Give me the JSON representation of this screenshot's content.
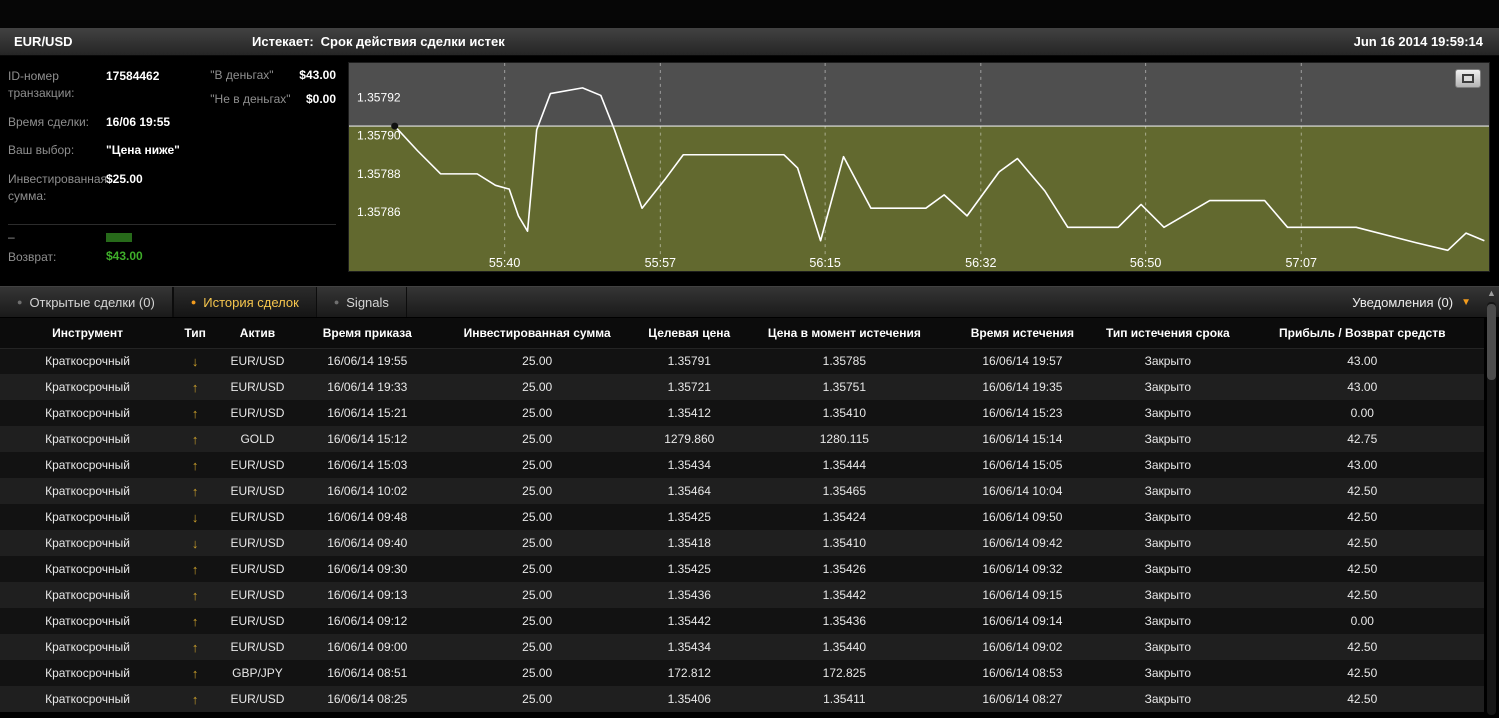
{
  "header": {
    "asset": "EUR/USD",
    "expires_label": "Истекает:",
    "expires_text": "Срок действия сделки истек",
    "datetime": "Jun 16 2014  19:59:14"
  },
  "trade_info": {
    "rows": [
      {
        "label": "ID-номер транзакции:",
        "value": "17584462"
      },
      {
        "label": "Время сделки:",
        "value": "16/06 19:55"
      },
      {
        "label": "Ваш выбор:",
        "value": "\"Цена ниже\""
      },
      {
        "label": "Инвестированная сумма:",
        "value": "$25.00"
      }
    ],
    "money_rows": [
      {
        "label": "\"В деньгах\"",
        "value": "$43.00"
      },
      {
        "label": "\"Не в деньгах\"",
        "value": "$0.00"
      }
    ],
    "obscured_label": "–",
    "return_label": "Возврат:",
    "return_value": "$43.00"
  },
  "chart_data": {
    "type": "line",
    "asset": "EUR/USD",
    "xlim": [
      23,
      147.5
    ],
    "ylim": [
      1.357838,
      1.357938
    ],
    "strike": 1.357905,
    "x_ticks": [
      {
        "x": 40,
        "label": "55:40"
      },
      {
        "x": 57,
        "label": "55:57"
      },
      {
        "x": 75,
        "label": "56:15"
      },
      {
        "x": 92,
        "label": "56:32"
      },
      {
        "x": 110,
        "label": "56:50"
      },
      {
        "x": 127,
        "label": "57:07"
      }
    ],
    "y_ticks": [
      1.35792,
      1.3579,
      1.35788,
      1.35786
    ],
    "points": [
      [
        28,
        1.357905
      ],
      [
        30.5,
        1.357892
      ],
      [
        33,
        1.35788
      ],
      [
        37,
        1.35788
      ],
      [
        39,
        1.357874
      ],
      [
        40.5,
        1.357872
      ],
      [
        41.5,
        1.357858
      ],
      [
        42.5,
        1.35785
      ],
      [
        43.5,
        1.357903
      ],
      [
        45,
        1.357922
      ],
      [
        48.5,
        1.357925
      ],
      [
        50.5,
        1.357921
      ],
      [
        52,
        1.357903
      ],
      [
        55,
        1.357862
      ],
      [
        57.5,
        1.357877
      ],
      [
        59.5,
        1.35789
      ],
      [
        70.5,
        1.35789
      ],
      [
        72,
        1.357883
      ],
      [
        74.5,
        1.357845
      ],
      [
        77,
        1.357889
      ],
      [
        80,
        1.357862
      ],
      [
        86,
        1.357862
      ],
      [
        88,
        1.357869
      ],
      [
        90.5,
        1.357858
      ],
      [
        94,
        1.357881
      ],
      [
        96,
        1.357888
      ],
      [
        99,
        1.357871
      ],
      [
        101.5,
        1.357852
      ],
      [
        107,
        1.357852
      ],
      [
        109.5,
        1.357864
      ],
      [
        112,
        1.357852
      ],
      [
        117,
        1.357866
      ],
      [
        123,
        1.357866
      ],
      [
        125.5,
        1.357852
      ],
      [
        133,
        1.357852
      ],
      [
        139.5,
        1.357844
      ],
      [
        143,
        1.35784
      ],
      [
        145,
        1.357849
      ],
      [
        147,
        1.357845
      ]
    ],
    "colors": {
      "above_strike": "#4f4f4f",
      "below_strike": "#62692f",
      "line": "#ffffff",
      "strike_line": "#e6e6e6",
      "marker": "#111111",
      "grid": "rgba(255,255,255,0.45)"
    },
    "legend": "none",
    "grid": "vertical-dashed"
  },
  "tabs": [
    {
      "label": "Открытые сделки (0)",
      "active": false
    },
    {
      "label": "История сделок",
      "active": true
    },
    {
      "label": "Signals",
      "active": false
    }
  ],
  "notifications": {
    "label": "Уведомления (0)"
  },
  "history": {
    "columns": [
      "Инструмент",
      "Тип",
      "Актив",
      "Время приказа",
      "Инвестированная сумма",
      "Целевая цена",
      "Цена в момент истечения",
      "Время истечения",
      "Тип истечения срока",
      "Прибыль / Возврат средств"
    ],
    "rows": [
      [
        "Краткосрочный",
        "down",
        "EUR/USD",
        "16/06/14 19:55",
        "25.00",
        "1.35791",
        "1.35785",
        "16/06/14 19:57",
        "Закрыто",
        "43.00"
      ],
      [
        "Краткосрочный",
        "up",
        "EUR/USD",
        "16/06/14 19:33",
        "25.00",
        "1.35721",
        "1.35751",
        "16/06/14 19:35",
        "Закрыто",
        "43.00"
      ],
      [
        "Краткосрочный",
        "up",
        "EUR/USD",
        "16/06/14 15:21",
        "25.00",
        "1.35412",
        "1.35410",
        "16/06/14 15:23",
        "Закрыто",
        "0.00"
      ],
      [
        "Краткосрочный",
        "up",
        "GOLD",
        "16/06/14 15:12",
        "25.00",
        "1279.860",
        "1280.115",
        "16/06/14 15:14",
        "Закрыто",
        "42.75"
      ],
      [
        "Краткосрочный",
        "up",
        "EUR/USD",
        "16/06/14 15:03",
        "25.00",
        "1.35434",
        "1.35444",
        "16/06/14 15:05",
        "Закрыто",
        "43.00"
      ],
      [
        "Краткосрочный",
        "up",
        "EUR/USD",
        "16/06/14 10:02",
        "25.00",
        "1.35464",
        "1.35465",
        "16/06/14 10:04",
        "Закрыто",
        "42.50"
      ],
      [
        "Краткосрочный",
        "down",
        "EUR/USD",
        "16/06/14 09:48",
        "25.00",
        "1.35425",
        "1.35424",
        "16/06/14 09:50",
        "Закрыто",
        "42.50"
      ],
      [
        "Краткосрочный",
        "down",
        "EUR/USD",
        "16/06/14 09:40",
        "25.00",
        "1.35418",
        "1.35410",
        "16/06/14 09:42",
        "Закрыто",
        "42.50"
      ],
      [
        "Краткосрочный",
        "up",
        "EUR/USD",
        "16/06/14 09:30",
        "25.00",
        "1.35425",
        "1.35426",
        "16/06/14 09:32",
        "Закрыто",
        "42.50"
      ],
      [
        "Краткосрочный",
        "up",
        "EUR/USD",
        "16/06/14 09:13",
        "25.00",
        "1.35436",
        "1.35442",
        "16/06/14 09:15",
        "Закрыто",
        "42.50"
      ],
      [
        "Краткосрочный",
        "up",
        "EUR/USD",
        "16/06/14 09:12",
        "25.00",
        "1.35442",
        "1.35436",
        "16/06/14 09:14",
        "Закрыто",
        "0.00"
      ],
      [
        "Краткосрочный",
        "up",
        "EUR/USD",
        "16/06/14 09:00",
        "25.00",
        "1.35434",
        "1.35440",
        "16/06/14 09:02",
        "Закрыто",
        "42.50"
      ],
      [
        "Краткосрочный",
        "up",
        "GBP/JPY",
        "16/06/14 08:51",
        "25.00",
        "172.812",
        "172.825",
        "16/06/14 08:53",
        "Закрыто",
        "42.50"
      ],
      [
        "Краткосрочный",
        "up",
        "EUR/USD",
        "16/06/14 08:25",
        "25.00",
        "1.35406",
        "1.35411",
        "16/06/14 08:27",
        "Закрыто",
        "42.50"
      ]
    ]
  }
}
